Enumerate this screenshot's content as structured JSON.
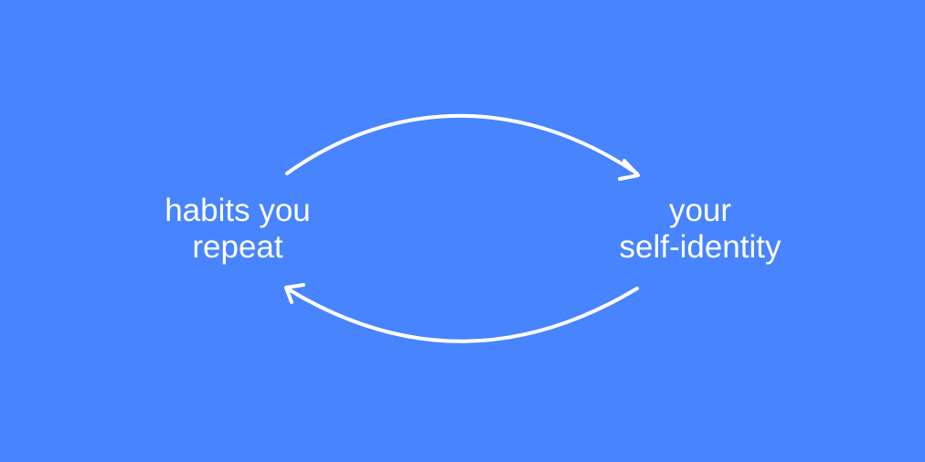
{
  "background_color": "#4884FD",
  "foreground_color": "#FFFFFF",
  "nodes": {
    "left": {
      "line1": "habits you",
      "line2": "repeat"
    },
    "right": {
      "line1": "your",
      "line2": "self-identity"
    }
  },
  "edges": [
    {
      "from": "habits you repeat",
      "to": "your self-identity",
      "icon": "curved-arrow-right-icon"
    },
    {
      "from": "your self-identity",
      "to": "habits you repeat",
      "icon": "curved-arrow-left-icon"
    }
  ]
}
